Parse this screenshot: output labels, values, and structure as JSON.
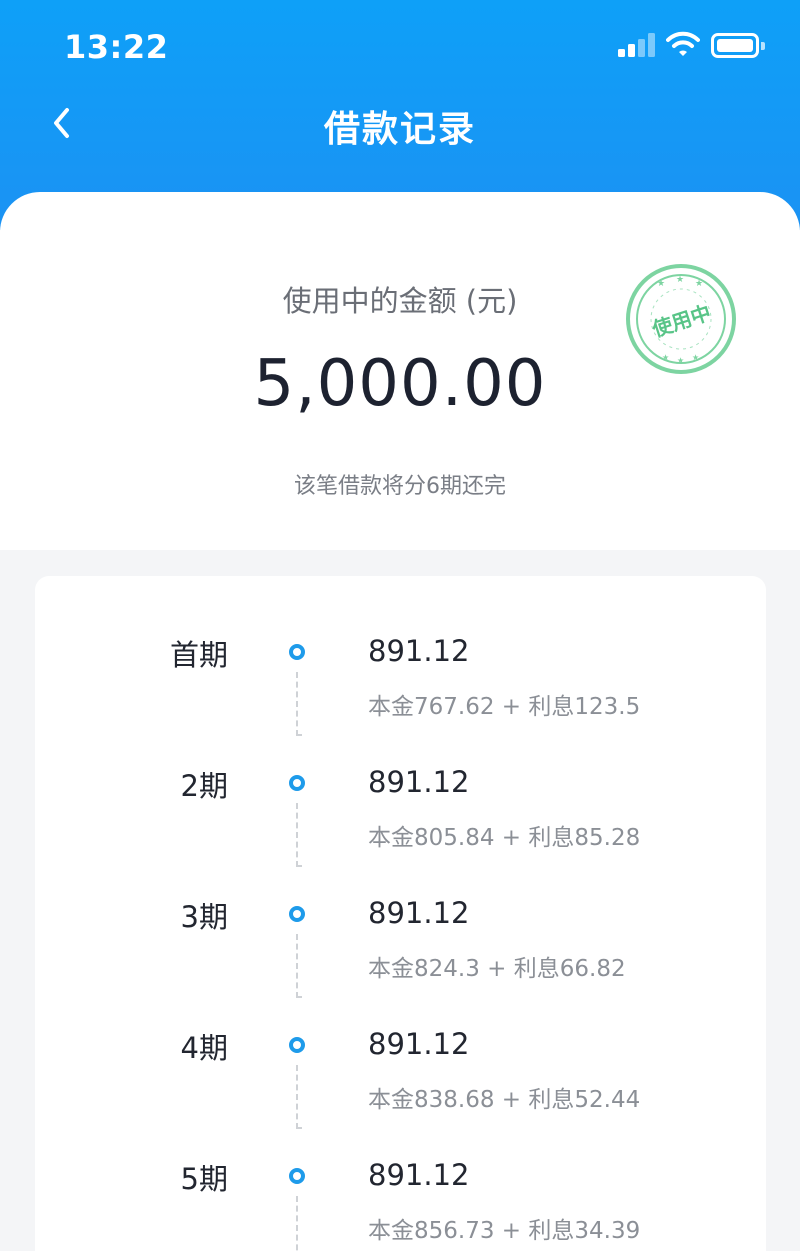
{
  "status_bar": {
    "time": "13:22"
  },
  "nav": {
    "title": "借款记录"
  },
  "summary": {
    "label": "使用中的金额 (元)",
    "amount": "5,000.00",
    "note": "该笔借款将分6期还完",
    "stamp": "使用中"
  },
  "installments": [
    {
      "period": "首期",
      "amount": "891.12",
      "detail": "本金767.62 + 利息123.5"
    },
    {
      "period": "2期",
      "amount": "891.12",
      "detail": "本金805.84 + 利息85.28"
    },
    {
      "period": "3期",
      "amount": "891.12",
      "detail": "本金824.3 + 利息66.82"
    },
    {
      "period": "4期",
      "amount": "891.12",
      "detail": "本金838.68 + 利息52.44"
    },
    {
      "period": "5期",
      "amount": "891.12",
      "detail": "本金856.73 + 利息34.39"
    }
  ],
  "colors": {
    "header": "#1b92f3",
    "timeline_node": "#1e9bea",
    "stamp": "#58c487"
  },
  "icons": {
    "back": "chevron-left-icon",
    "signal": "cellular-signal-icon",
    "wifi": "wifi-icon",
    "battery": "battery-icon"
  }
}
